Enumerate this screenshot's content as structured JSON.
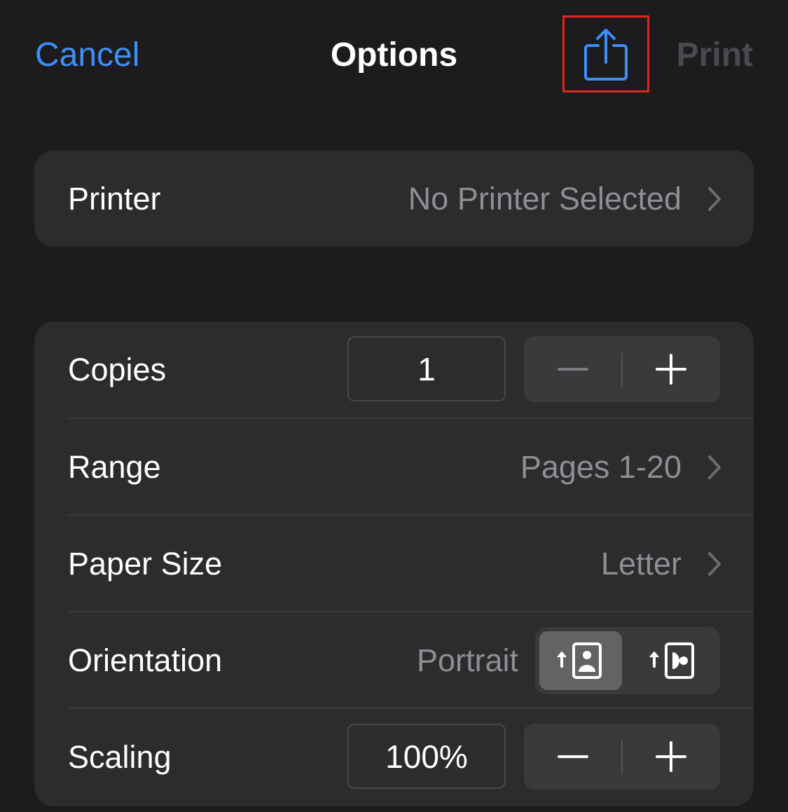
{
  "nav": {
    "cancel_label": "Cancel",
    "title": "Options",
    "share_icon": "share-icon",
    "print_label": "Print"
  },
  "printer": {
    "label": "Printer",
    "value": "No Printer Selected"
  },
  "copies": {
    "label": "Copies",
    "value": "1",
    "decrement_icon": "minus-icon",
    "increment_icon": "plus-icon"
  },
  "range": {
    "label": "Range",
    "value": "Pages 1-20"
  },
  "paper_size": {
    "label": "Paper Size",
    "value": "Letter"
  },
  "orientation": {
    "label": "Orientation",
    "value": "Portrait",
    "options": [
      "portrait-icon",
      "landscape-icon"
    ],
    "selected": "portrait"
  },
  "scaling": {
    "label": "Scaling",
    "value": "100%",
    "decrement_icon": "minus-icon",
    "increment_icon": "plus-icon"
  },
  "colors": {
    "accent": "#3e8ef7",
    "highlight_box": "#e1251b",
    "background": "#1c1c1e",
    "group_background": "#2c2c2e",
    "secondary_text": "#8e8e93",
    "disabled_text": "#4a4a4e"
  }
}
